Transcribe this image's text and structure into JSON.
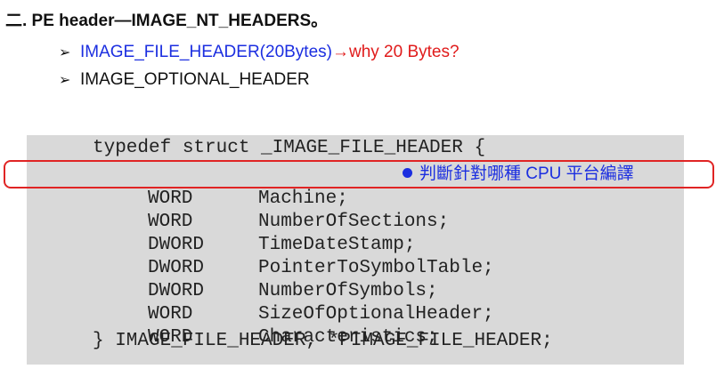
{
  "heading": "二. PE header—IMAGE_NT_HEADERS。",
  "bullets": [
    {
      "marker": "➢",
      "text": "IMAGE_FILE_HEADER(20Bytes)",
      "arrow": "→",
      "question": "why 20 Bytes?"
    },
    {
      "marker": "➢",
      "text": "IMAGE_OPTIONAL_HEADER"
    }
  ],
  "code": {
    "open": "typedef struct _IMAGE_FILE_HEADER {",
    "members": [
      {
        "type": "WORD",
        "field": "Machine;"
      },
      {
        "type": "WORD",
        "field": "NumberOfSections;"
      },
      {
        "type": "DWORD",
        "field": "TimeDateStamp;"
      },
      {
        "type": "DWORD",
        "field": "PointerToSymbolTable;"
      },
      {
        "type": "DWORD",
        "field": "NumberOfSymbols;"
      },
      {
        "type": "WORD",
        "field": "SizeOfOptionalHeader;"
      },
      {
        "type": "WORD",
        "field": "Characteristics;"
      }
    ],
    "close": "} IMAGE_FILE_HEADER, *PIMAGE_FILE_HEADER;"
  },
  "annotation": "判斷針對哪種 CPU 平台編譯",
  "colors": {
    "accent_blue": "#1b2ee0",
    "accent_red": "#e01b1b",
    "code_bg": "#d9d9d9"
  }
}
